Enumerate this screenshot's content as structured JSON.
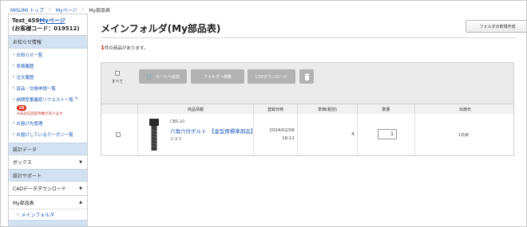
{
  "breadcrumb": {
    "items": [
      "MISUMI トップ",
      "Myページ"
    ],
    "current": "My部品表"
  },
  "sidebar": {
    "user_prefix": "Test_459",
    "user_mypage": "Myページ",
    "customer_code": "(お客様コード：019512)",
    "info_header": "お知らせ情報",
    "info_items": [
      "お知らせ一覧",
      "見積履歴",
      "注文履歴",
      "返品・交換申請一覧",
      "納期型番確認リクエスト一覧",
      "お届け先管理",
      "お届けしているクーポン一覧"
    ],
    "request_badge": "20",
    "request_note": "※未対応回答件数があります",
    "design_data_header": "設計データ",
    "box_label": "ボックス",
    "design_support_header": "設計サポート",
    "cad_label": "CADデータダウンロード",
    "parts_list_label": "My部品表",
    "main_folder_link": "メインフォルダ"
  },
  "main": {
    "title": "メインフォルダ(My部品表)",
    "new_folder_button": "フォルダの新規作成",
    "count_number": "1",
    "count_suffix": "件の商品があります。",
    "select_all_label": "すべて",
    "toolbar": {
      "add_to_cart": "カートへ追加",
      "move_to_folder": "フォルダへ移動",
      "csv_download": "CSVダウンロード"
    },
    "columns": [
      "商品情報",
      "登録日時",
      "単価(税別)",
      "数量",
      "出荷日"
    ],
    "row": {
      "code": "CBS-10",
      "name": "六角穴付ボルト　【金型用標準部品】",
      "maker": "ミスミ",
      "date": "2024/02/06",
      "time": "18:11",
      "price": "4",
      "quantity": "1",
      "ship": "1日目"
    }
  },
  "colors": {
    "link": "#1a56b8",
    "accent_red": "#d42a1a",
    "section_header": "#d3e2f2",
    "button_gray": "#b2b2b2"
  }
}
